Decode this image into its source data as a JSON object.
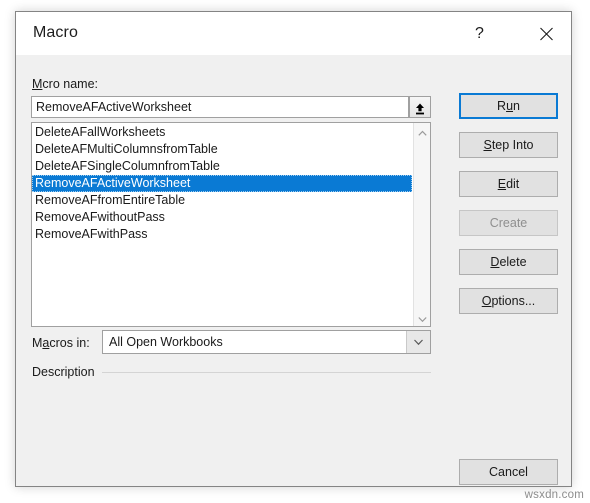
{
  "dialog": {
    "title": "Macro",
    "titlebar_buttons": [
      {
        "name": "help",
        "glyph": "?"
      },
      {
        "name": "close",
        "glyph": "×"
      }
    ]
  },
  "macro_name": {
    "label_prefix": "M",
    "label_accel": "a",
    "label_suffix": "cro name:",
    "value": "RemoveAFActiveWorksheet",
    "placeholder": "",
    "upload_button_icon": "upload-arrow-icon"
  },
  "macro_list": {
    "items": [
      {
        "label": "DeleteAFallWorksheets",
        "selected": false
      },
      {
        "label": "DeleteAFMultiColumnsfromTable",
        "selected": false
      },
      {
        "label": "DeleteAFSingleColumnfromTable",
        "selected": false
      },
      {
        "label": "RemoveAFActiveWorksheet",
        "selected": true
      },
      {
        "label": "RemoveAFfromEntireTable",
        "selected": false
      },
      {
        "label": "RemoveAFwithoutPass",
        "selected": false
      },
      {
        "label": "RemoveAFwithPass",
        "selected": false
      }
    ],
    "selection_color": "#0a7ad4",
    "scrollbar": {
      "up_icon": "chevron-up-icon",
      "down_icon": "chevron-down-icon"
    }
  },
  "macros_in": {
    "label_prefix": "M",
    "label_accel": "a",
    "label_suffix": "cros in:",
    "selected_option": "All Open Workbooks",
    "options": [
      "All Open Workbooks"
    ],
    "dropdown_icon": "chevron-down-icon"
  },
  "description": {
    "label": "Description",
    "text": ""
  },
  "buttons": [
    {
      "id": "run",
      "prefix": "R",
      "accel": "u",
      "suffix": "n",
      "state": "default"
    },
    {
      "id": "step_into",
      "prefix": "",
      "accel": "S",
      "suffix": "tep Into",
      "state": "normal"
    },
    {
      "id": "edit",
      "prefix": "",
      "accel": "E",
      "suffix": "dit",
      "state": "normal"
    },
    {
      "id": "create",
      "prefix": "",
      "accel": "",
      "suffix": "Create",
      "state": "disabled"
    },
    {
      "id": "delete",
      "prefix": "",
      "accel": "D",
      "suffix": "elete",
      "state": "normal"
    },
    {
      "id": "options",
      "prefix": "",
      "accel": "O",
      "suffix": "ptions...",
      "state": "normal"
    },
    {
      "id": "cancel",
      "prefix": "",
      "accel": "",
      "suffix": "Cancel",
      "state": "normal"
    }
  ],
  "watermark": "wsxdn.com"
}
